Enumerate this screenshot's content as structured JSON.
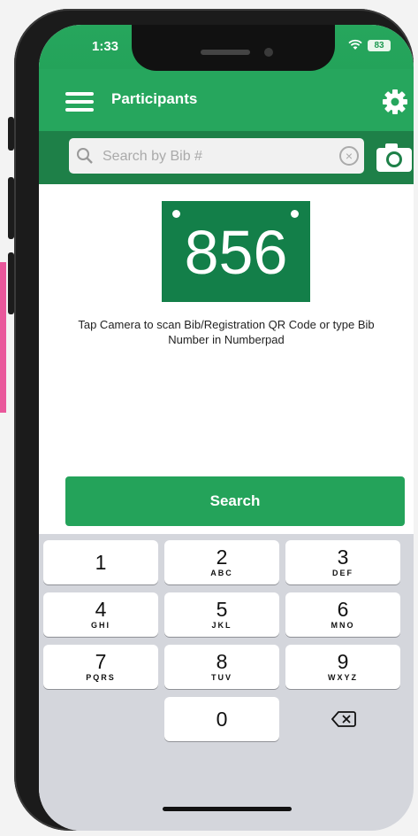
{
  "status_bar": {
    "time": "1:33",
    "battery": "83"
  },
  "app_bar": {
    "title": "Participants"
  },
  "search": {
    "placeholder": "Search by Bib #"
  },
  "bib": {
    "number": "856"
  },
  "instruction": "Tap Camera to scan Bib/Registration QR Code or type Bib Number in Numberpad",
  "search_button": "Search",
  "keypad": {
    "keys": [
      {
        "num": "1",
        "letters": ""
      },
      {
        "num": "2",
        "letters": "ABC"
      },
      {
        "num": "3",
        "letters": "DEF"
      },
      {
        "num": "4",
        "letters": "GHI"
      },
      {
        "num": "5",
        "letters": "JKL"
      },
      {
        "num": "6",
        "letters": "MNO"
      },
      {
        "num": "7",
        "letters": "PQRS"
      },
      {
        "num": "8",
        "letters": "TUV"
      },
      {
        "num": "9",
        "letters": "WXYZ"
      },
      {
        "num": "0",
        "letters": ""
      }
    ]
  },
  "colors": {
    "primary_green": "#26a65d",
    "dark_green": "#1e8048",
    "bib_green": "#137f49"
  },
  "icons": {
    "menu": "hamburger-icon",
    "settings": "gear-icon",
    "search": "search-icon",
    "clear": "clear-icon",
    "camera": "camera-icon",
    "backspace": "backspace-icon"
  }
}
